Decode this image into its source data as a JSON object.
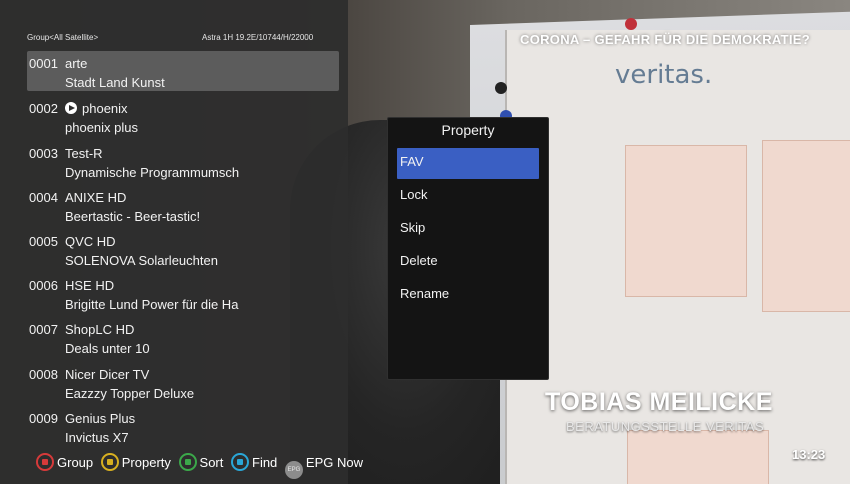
{
  "header": {
    "group_label": "Group<All Satellite>",
    "satellite_info": "Astra 1H 19.2E/10744/H/22000"
  },
  "channels": [
    {
      "number": "0001",
      "name": "arte",
      "program": "Stadt Land Kunst",
      "selected": true,
      "playing": false
    },
    {
      "number": "0002",
      "name": "phoenix",
      "program": "phoenix plus",
      "selected": false,
      "playing": true
    },
    {
      "number": "0003",
      "name": "Test-R",
      "program": "Dynamische Programmumsch",
      "selected": false,
      "playing": false
    },
    {
      "number": "0004",
      "name": "ANIXE HD",
      "program": "Beertastic - Beer-tastic!",
      "selected": false,
      "playing": false
    },
    {
      "number": "0005",
      "name": "QVC HD",
      "program": "SOLENOVA Solarleuchten",
      "selected": false,
      "playing": false
    },
    {
      "number": "0006",
      "name": "HSE HD",
      "program": "Brigitte Lund Power für die Ha",
      "selected": false,
      "playing": false
    },
    {
      "number": "0007",
      "name": "ShopLC HD",
      "program": "Deals unter 10",
      "selected": false,
      "playing": false
    },
    {
      "number": "0008",
      "name": "Nicer Dicer TV",
      "program": "Eazzzy Topper Deluxe",
      "selected": false,
      "playing": false
    },
    {
      "number": "0009",
      "name": "Genius Plus",
      "program": "Invictus X7",
      "selected": false,
      "playing": false
    }
  ],
  "popup": {
    "title": "Property",
    "items": [
      "FAV",
      "Lock",
      "Skip",
      "Delete",
      "Rename"
    ],
    "selected_index": 0
  },
  "hints": [
    {
      "key": "red-key-icon",
      "label": "Group",
      "color": "#d63a3a"
    },
    {
      "key": "yellow-key-icon",
      "label": "Property",
      "color": "#d8b020"
    },
    {
      "key": "green-key-icon",
      "label": "Sort",
      "color": "#3ba84a"
    },
    {
      "key": "blue-key-icon",
      "label": "Find",
      "color": "#2aa7d8"
    },
    {
      "key": "epg-key-icon",
      "label": "EPG Now",
      "icon_text": "EPG"
    }
  ],
  "video": {
    "headline": "CORONA – GEFAHR FÜR DIE DEMOKRATIE?",
    "brand": "veritas.",
    "name": "TOBIAS MEILICKE",
    "subtitle": "BERATUNGSSTELLE VERITAS",
    "clock": "13:23"
  },
  "colors": {
    "selection": "#3a5fc3",
    "list_selection": "#5c5c5c"
  }
}
